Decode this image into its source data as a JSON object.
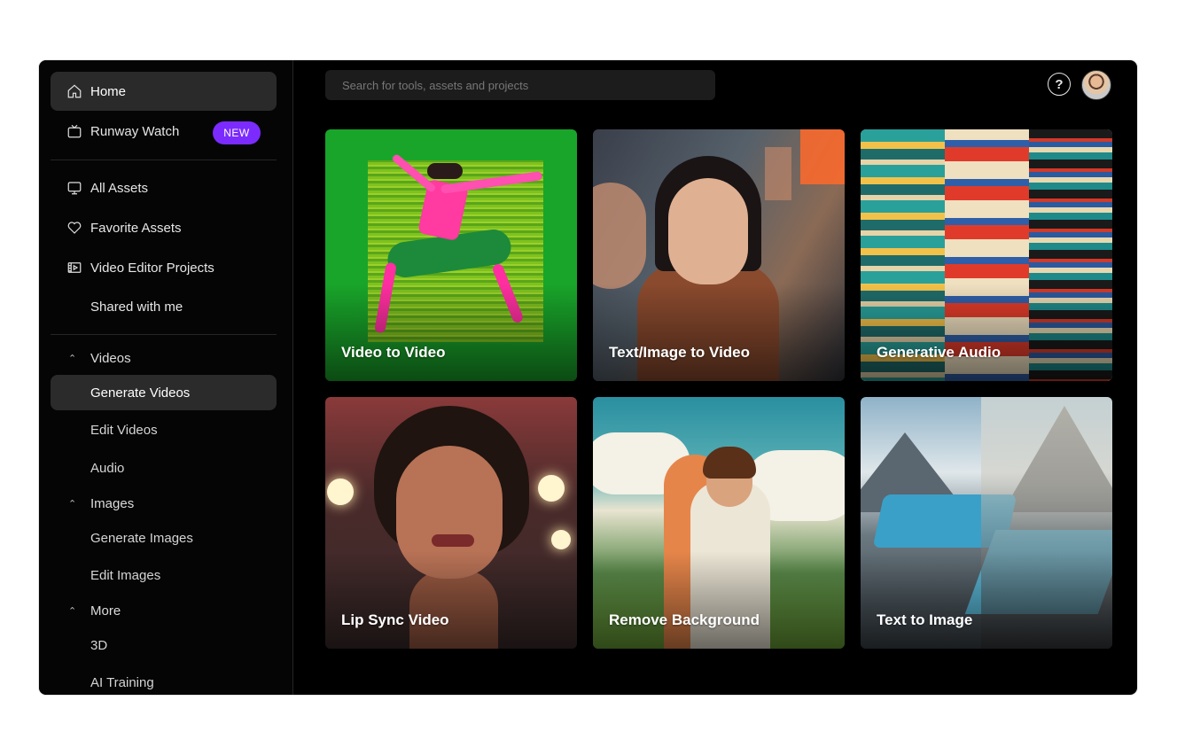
{
  "sidebar": {
    "home": "Home",
    "runway_watch": "Runway Watch",
    "new_badge": "NEW",
    "all_assets": "All Assets",
    "favorite_assets": "Favorite Assets",
    "video_editor_projects": "Video Editor Projects",
    "shared_with_me": "Shared with me",
    "videos_section": "Videos",
    "generate_videos": "Generate Videos",
    "edit_videos": "Edit Videos",
    "audio": "Audio",
    "images_section": "Images",
    "generate_images": "Generate Images",
    "edit_images": "Edit Images",
    "more_section": "More",
    "three_d": "3D",
    "ai_training": "AI Training"
  },
  "header": {
    "search_placeholder": "Search for tools, assets and projects",
    "help_glyph": "?"
  },
  "tools": [
    {
      "label": "Video to Video"
    },
    {
      "label": "Text/Image to Video"
    },
    {
      "label": "Generative Audio"
    },
    {
      "label": "Lip Sync Video"
    },
    {
      "label": "Remove Background"
    },
    {
      "label": "Text to Image"
    }
  ],
  "colors": {
    "accent_purple": "#7c2bff",
    "background": "#000000",
    "active_item": "#2a2a2a"
  }
}
